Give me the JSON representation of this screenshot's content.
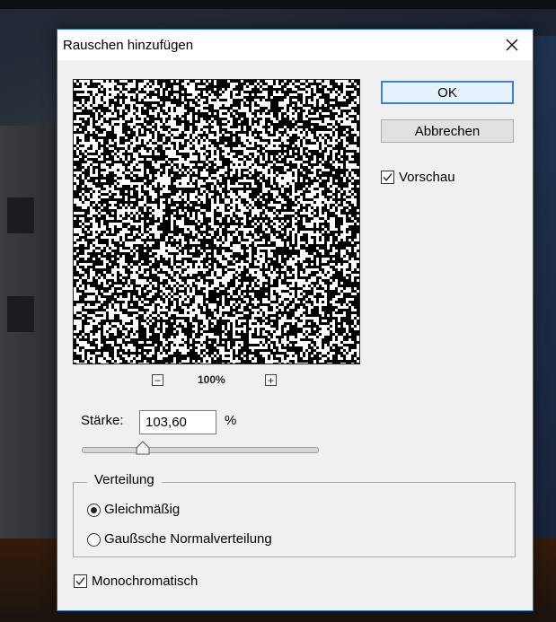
{
  "dialog": {
    "title": "Rauschen hinzufügen",
    "close_icon": "close-icon"
  },
  "buttons": {
    "ok": "OK",
    "cancel": "Abbrechen"
  },
  "preview": {
    "checkbox_label": "Vorschau",
    "checked": true,
    "zoom": "100%",
    "zoom_out_symbol": "−",
    "zoom_in_symbol": "+"
  },
  "strength": {
    "label": "Stärke:",
    "value": "103,60",
    "unit": "%",
    "slider_fraction": 0.26
  },
  "distribution": {
    "title": "Verteilung",
    "options": [
      {
        "label": "Gleichmäßig",
        "selected": true
      },
      {
        "label": "Gaußsche Normalverteilung",
        "selected": false
      }
    ]
  },
  "monochromatic": {
    "label": "Monochromatisch",
    "checked": true
  },
  "colors": {
    "accent": "#3c7fd6",
    "dialog_bg": "#f0f0f0"
  }
}
